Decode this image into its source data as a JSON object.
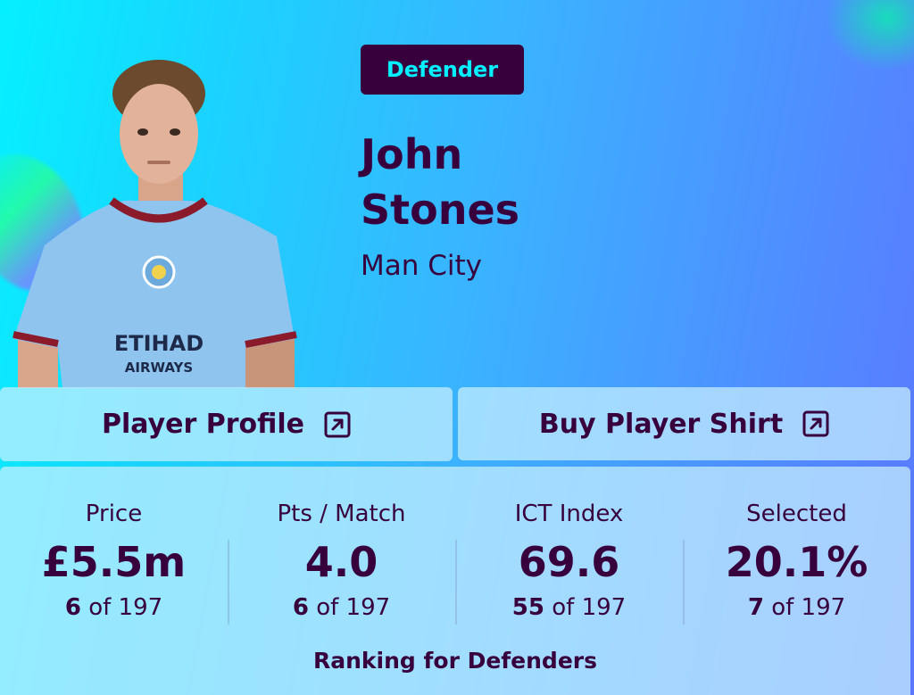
{
  "player": {
    "position": "Defender",
    "first_name": "John",
    "last_name": "Stones",
    "team": "Man City",
    "shirt_sponsor_line1": "ETIHAD",
    "shirt_sponsor_line2": "AIRWAYS"
  },
  "buttons": {
    "profile_label": "Player Profile",
    "shirt_label": "Buy Player Shirt"
  },
  "stats": [
    {
      "label": "Price",
      "value": "£5.5m",
      "rank": "6",
      "of_text": "of 197"
    },
    {
      "label": "Pts / Match",
      "value": "4.0",
      "rank": "6",
      "of_text": "of 197"
    },
    {
      "label": "ICT Index",
      "value": "69.6",
      "rank": "55",
      "of_text": "of 197"
    },
    {
      "label": "Selected",
      "value": "20.1%",
      "rank": "7",
      "of_text": "of 197"
    }
  ],
  "ranking_caption": "Ranking for Defenders",
  "colors": {
    "primary_purple": "#37003c",
    "accent_cyan": "#05f0ff",
    "shirt_sky_blue": "#8ec4ee",
    "shirt_trim_maroon": "#8b1a2b"
  },
  "icons": {
    "external_link": "external-link-icon"
  }
}
